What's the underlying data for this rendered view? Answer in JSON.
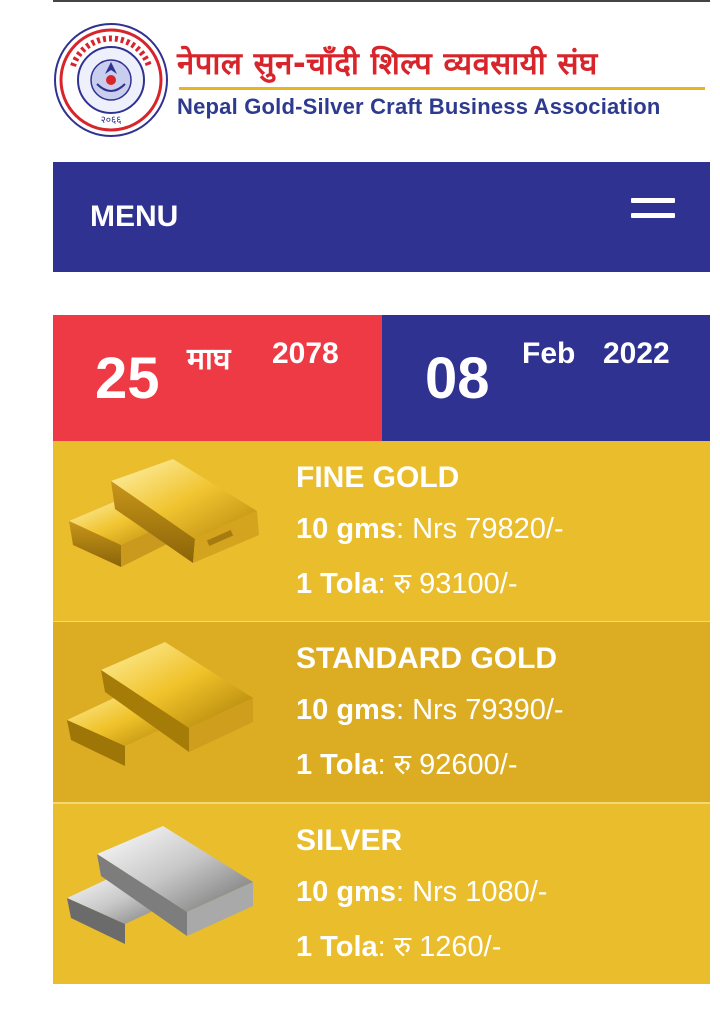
{
  "header": {
    "title_nepali": "नेपाल सुन-चाँदी शिल्प व्यवसायी संघ",
    "title_english": "Nepal Gold-Silver Craft Business Association",
    "logo_year": "२०६६"
  },
  "menu": {
    "label": "MENU"
  },
  "date": {
    "nepali": {
      "day": "25",
      "month": "माघ",
      "year": "2078"
    },
    "english": {
      "day": "08",
      "month": "Feb",
      "year": "2022"
    }
  },
  "rates": [
    {
      "name": "FINE GOLD",
      "gms_label": "10 gms",
      "gms_value": ": Nrs 79820/-",
      "tola_label": "1 Tola",
      "tola_value": ": रु 93100/-"
    },
    {
      "name": "STANDARD GOLD",
      "gms_label": "10 gms",
      "gms_value": ": Nrs 79390/-",
      "tola_label": "1 Tola",
      "tola_value": ": रु 92600/-"
    },
    {
      "name": "SILVER",
      "gms_label": "10 gms",
      "gms_value": ": Nrs 1080/-",
      "tola_label": "1 Tola",
      "tola_value": ": रु 1260/-"
    }
  ],
  "colors": {
    "brand_red": "#d8242b",
    "brand_blue": "#2f3290",
    "date_red": "#ee3a45",
    "gold_panel": "#e9bd2c"
  }
}
